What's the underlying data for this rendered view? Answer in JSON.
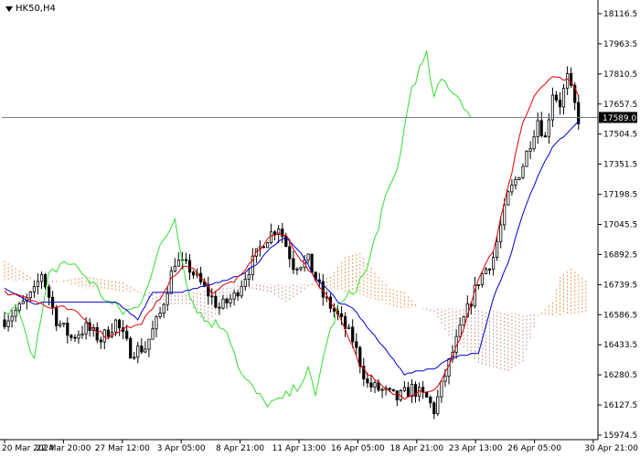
{
  "symbol": {
    "name": "HK50",
    "timeframe": "H4",
    "title": "HK50,H4"
  },
  "colors": {
    "background": "#ffffff",
    "candle": "#000000",
    "tenkan": "#e00000",
    "kijun": "#0000c8",
    "chikou": "#33dd33",
    "senkou_a": "#ee9955",
    "senkou_b": "#cc9999",
    "current_price_line": "#708090",
    "current_price_tag": "#000000"
  },
  "current_price": "17589.0",
  "chart_data": {
    "type": "candlestick",
    "indicator": "Ichimoku Kinko Hyo",
    "y_ticks": [
      "18116.5",
      "17963.5",
      "17810.5",
      "17657.5",
      "17504.5",
      "17351.5",
      "17198.5",
      "17045.5",
      "16892.5",
      "16739.5",
      "16586.5",
      "16433.5",
      "16280.5",
      "16127.5",
      "15974.5"
    ],
    "ylim": [
      15974.5,
      18116.5
    ],
    "x_ticks": [
      "20 Mar 2024",
      "22 Mar 20:00",
      "27 Mar 12:00",
      "3 Apr 05:00",
      "8 Apr 21:00",
      "11 Apr 13:00",
      "16 Apr 05:00",
      "18 Apr 21:00",
      "23 Apr 13:00",
      "26 Apr 05:00",
      "30 Apr 21:00"
    ],
    "grid": false,
    "price_line": 17589.0,
    "anchors": {
      "close": [
        [
          0,
          16560
        ],
        [
          4,
          16620
        ],
        [
          8,
          16700
        ],
        [
          10,
          16800
        ],
        [
          14,
          16560
        ],
        [
          18,
          16470
        ],
        [
          22,
          16520
        ],
        [
          26,
          16460
        ],
        [
          30,
          16550
        ],
        [
          34,
          16400
        ],
        [
          38,
          16420
        ],
        [
          42,
          16590
        ],
        [
          46,
          16860
        ],
        [
          50,
          16820
        ],
        [
          54,
          16720
        ],
        [
          58,
          16620
        ],
        [
          62,
          16680
        ],
        [
          66,
          16820
        ],
        [
          70,
          16960
        ],
        [
          74,
          17040
        ],
        [
          78,
          16840
        ],
        [
          82,
          16860
        ],
        [
          86,
          16680
        ],
        [
          90,
          16580
        ],
        [
          94,
          16460
        ],
        [
          98,
          16230
        ],
        [
          102,
          16200
        ],
        [
          106,
          16160
        ],
        [
          110,
          16210
        ],
        [
          114,
          16160
        ],
        [
          116,
          16100
        ],
        [
          120,
          16340
        ],
        [
          124,
          16560
        ],
        [
          128,
          16760
        ],
        [
          132,
          16880
        ],
        [
          136,
          17190
        ],
        [
          140,
          17350
        ],
        [
          144,
          17580
        ],
        [
          146,
          17480
        ],
        [
          148,
          17720
        ],
        [
          150,
          17660
        ],
        [
          152,
          17790
        ],
        [
          155,
          17580
        ]
      ],
      "tenkan": [
        [
          0,
          16700
        ],
        [
          6,
          16680
        ],
        [
          12,
          16620
        ],
        [
          16,
          16620
        ],
        [
          20,
          16590
        ],
        [
          24,
          16520
        ],
        [
          28,
          16470
        ],
        [
          32,
          16520
        ],
        [
          36,
          16530
        ],
        [
          40,
          16610
        ],
        [
          44,
          16740
        ],
        [
          48,
          16830
        ],
        [
          52,
          16810
        ],
        [
          56,
          16700
        ],
        [
          60,
          16740
        ],
        [
          64,
          16780
        ],
        [
          68,
          16900
        ],
        [
          72,
          16990
        ],
        [
          76,
          16990
        ],
        [
          80,
          16870
        ],
        [
          84,
          16760
        ],
        [
          88,
          16660
        ],
        [
          92,
          16520
        ],
        [
          96,
          16330
        ],
        [
          100,
          16250
        ],
        [
          104,
          16190
        ],
        [
          108,
          16170
        ],
        [
          112,
          16200
        ],
        [
          116,
          16200
        ],
        [
          120,
          16320
        ],
        [
          124,
          16520
        ],
        [
          128,
          16770
        ],
        [
          132,
          16910
        ],
        [
          136,
          17230
        ],
        [
          140,
          17560
        ],
        [
          144,
          17730
        ],
        [
          148,
          17790
        ],
        [
          152,
          17790
        ],
        [
          155,
          17710
        ]
      ],
      "kijun": [
        [
          0,
          16720
        ],
        [
          4,
          16680
        ],
        [
          8,
          16640
        ],
        [
          12,
          16650
        ],
        [
          16,
          16650
        ],
        [
          24,
          16650
        ],
        [
          30,
          16650
        ],
        [
          36,
          16560
        ],
        [
          40,
          16700
        ],
        [
          48,
          16700
        ],
        [
          52,
          16720
        ],
        [
          56,
          16740
        ],
        [
          60,
          16760
        ],
        [
          64,
          16790
        ],
        [
          68,
          16840
        ],
        [
          72,
          16930
        ],
        [
          76,
          16980
        ],
        [
          80,
          16900
        ],
        [
          84,
          16770
        ],
        [
          88,
          16700
        ],
        [
          90,
          16650
        ],
        [
          94,
          16620
        ],
        [
          98,
          16520
        ],
        [
          102,
          16430
        ],
        [
          106,
          16330
        ],
        [
          108,
          16280
        ],
        [
          112,
          16300
        ],
        [
          116,
          16310
        ],
        [
          120,
          16360
        ],
        [
          124,
          16380
        ],
        [
          128,
          16390
        ],
        [
          132,
          16670
        ],
        [
          136,
          16850
        ],
        [
          140,
          17100
        ],
        [
          144,
          17290
        ],
        [
          148,
          17440
        ],
        [
          152,
          17510
        ],
        [
          155,
          17570
        ]
      ],
      "chikou": [
        [
          0,
          16580
        ],
        [
          4,
          16620
        ],
        [
          8,
          16360
        ],
        [
          12,
          16780
        ],
        [
          16,
          16860
        ],
        [
          20,
          16820
        ],
        [
          24,
          16740
        ],
        [
          28,
          16650
        ],
        [
          32,
          16600
        ],
        [
          36,
          16620
        ],
        [
          42,
          16920
        ],
        [
          46,
          17080
        ],
        [
          50,
          16680
        ],
        [
          54,
          16560
        ],
        [
          60,
          16520
        ],
        [
          64,
          16280
        ],
        [
          70,
          16140
        ],
        [
          74,
          16140
        ],
        [
          78,
          16200
        ],
        [
          82,
          16300
        ],
        [
          84,
          16160
        ],
        [
          86,
          16380
        ],
        [
          90,
          16620
        ],
        [
          94,
          16700
        ],
        [
          98,
          16820
        ],
        [
          102,
          17120
        ],
        [
          106,
          17320
        ],
        [
          110,
          17750
        ],
        [
          114,
          17900
        ],
        [
          116,
          17680
        ],
        [
          118,
          17780
        ],
        [
          120,
          17750
        ],
        [
          124,
          17660
        ],
        [
          126,
          17570
        ]
      ],
      "senkou_a": [
        [
          0,
          16860
        ],
        [
          10,
          16740
        ],
        [
          22,
          16780
        ],
        [
          32,
          16750
        ],
        [
          42,
          16640
        ],
        [
          50,
          16640
        ],
        [
          54,
          16550
        ],
        [
          58,
          16600
        ],
        [
          62,
          16680
        ],
        [
          66,
          16720
        ],
        [
          72,
          16700
        ],
        [
          76,
          16650
        ],
        [
          80,
          16700
        ],
        [
          84,
          16760
        ],
        [
          88,
          16780
        ],
        [
          92,
          16880
        ],
        [
          96,
          16900
        ],
        [
          100,
          16800
        ],
        [
          104,
          16720
        ],
        [
          108,
          16700
        ],
        [
          112,
          16620
        ],
        [
          116,
          16600
        ],
        [
          120,
          16480
        ],
        [
          124,
          16420
        ],
        [
          128,
          16340
        ],
        [
          132,
          16320
        ],
        [
          136,
          16300
        ],
        [
          140,
          16350
        ],
        [
          144,
          16580
        ],
        [
          148,
          16650
        ],
        [
          150,
          16780
        ],
        [
          153,
          16820
        ],
        [
          157,
          16760
        ]
      ],
      "senkou_b": [
        [
          0,
          16760
        ],
        [
          14,
          16760
        ],
        [
          22,
          16720
        ],
        [
          32,
          16700
        ],
        [
          42,
          16700
        ],
        [
          52,
          16700
        ],
        [
          62,
          16740
        ],
        [
          72,
          16740
        ],
        [
          82,
          16740
        ],
        [
          96,
          16690
        ],
        [
          106,
          16620
        ],
        [
          116,
          16620
        ],
        [
          122,
          16620
        ],
        [
          130,
          16610
        ],
        [
          140,
          16590
        ],
        [
          148,
          16580
        ],
        [
          153,
          16590
        ],
        [
          157,
          16590
        ]
      ]
    },
    "candle_count": 156
  }
}
